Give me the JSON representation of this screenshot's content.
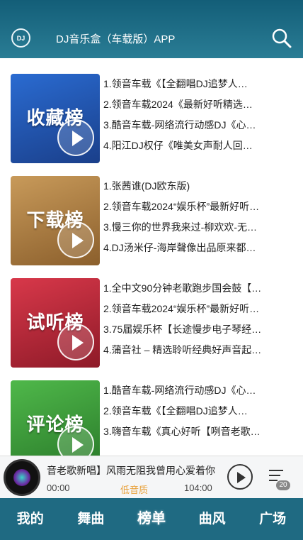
{
  "header": {
    "logo_text": "DJ",
    "title": "DJ音乐盒（车载版）APP",
    "search_icon": "search-icon"
  },
  "charts": [
    {
      "cover_title": "收藏榜",
      "cover_color": "#2a6bd1",
      "tracks": [
        "1.领音车载《【全翻唱DJ追梦人…",
        "2.领音车载2024《最新好听精选…",
        "3.酷音车载-网络流行动感DJ《心…",
        "4.阳江DJ权仔《唯美女声耐人回…"
      ]
    },
    {
      "cover_title": "下载榜",
      "cover_color": "#b8874a",
      "tracks": [
        "1.张茜谁(DJ欧东版)",
        "2.领音车载2024“娱乐杯”最新好听…",
        "3.慢三你的世界我来过-柳欢欢-无…",
        "4.DJ汤米仔-海岸聲像出品原来都…"
      ]
    },
    {
      "cover_title": "试听榜",
      "cover_color": "#c8273a",
      "tracks": [
        "1.全中文90分钟老歌跑步国会鼓【…",
        "2.领音车载2024“娱乐杯”最新好听…",
        "3.75届娱乐杯【长途慢步电子琴经…",
        "4.蒲音社 – 精选聆听经典好声音起…"
      ]
    },
    {
      "cover_title": "评论榜",
      "cover_color": "#3aa13a",
      "tracks": [
        "1.酷音车载-网络流行动感DJ《心…",
        "2.领音车载《【全翻唱DJ追梦人…",
        "3.嗨音车载《真心好听【咧音老歌…"
      ]
    }
  ],
  "player": {
    "now_playing": "音老歌新唱】风雨无阻我曾用心爱着你",
    "time_current": "00:00",
    "quality": "低音质",
    "time_total": "104:00",
    "playlist_count": "20"
  },
  "tabs": [
    "我的",
    "舞曲",
    "榜单",
    "曲风",
    "广场"
  ],
  "active_tab": "榜单"
}
